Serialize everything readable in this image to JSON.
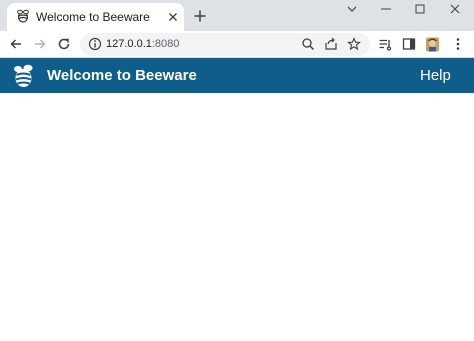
{
  "browser": {
    "tab": {
      "title": "Welcome to Beeware",
      "favicon": "bee-icon"
    },
    "address": {
      "host": "127.0.0.1",
      "port": ":8080"
    },
    "colors": {
      "tabstrip": "#dee1e6",
      "omnibox": "#f1f3f4"
    }
  },
  "app": {
    "title": "Welcome to Beeware",
    "help_label": "Help",
    "logo": "bee-logo-icon",
    "colors": {
      "header": "#0f5d8a",
      "header_text": "#ffffff"
    }
  }
}
